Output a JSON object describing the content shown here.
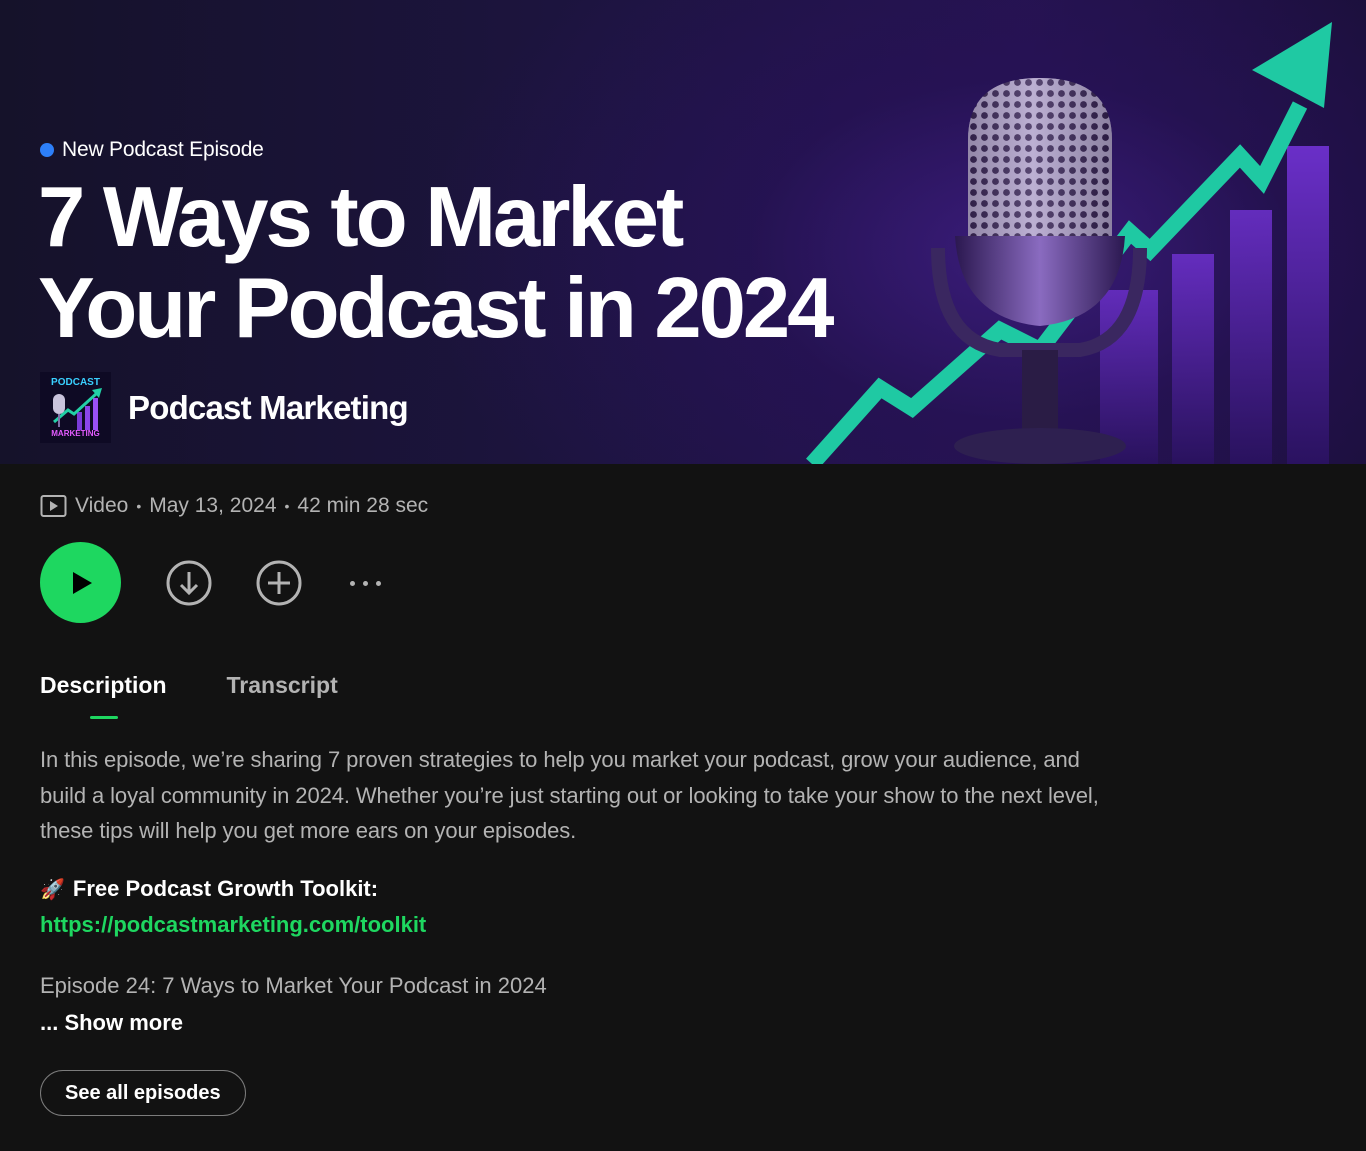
{
  "hero": {
    "badge": "New Podcast Episode",
    "title_line1": "7 Ways to Market",
    "title_line2": "Your Podcast in 2024",
    "show_name": "Podcast Marketing",
    "logo_top": "PODCAST",
    "logo_bottom": "MARKETING"
  },
  "meta": {
    "type": "Video",
    "separator": "•",
    "date": "May 13, 2024",
    "duration": "42 min 28 sec"
  },
  "actions": {
    "play_icon": "play-icon",
    "download_icon": "download-icon",
    "add_icon": "add-icon",
    "more_icon": "more-icon"
  },
  "tabs": {
    "description": "Description",
    "transcript": "Transcript",
    "active": "Description"
  },
  "description": {
    "paragraph": "In this episode, we’re sharing 7 proven strategies to help you market your podcast, grow your audience, and build a loyal community in 2024. Whether you’re just starting out or looking to take your show to the next level, these tips will help you get more ears on your episodes.",
    "toolkit_emoji": "🚀",
    "toolkit_label": "Free Podcast Growth Toolkit:",
    "toolkit_url": "https://podcastmarketing.com/toolkit",
    "episode_line": "Episode 24: 7 Ways to Market Your Podcast in 2024",
    "show_more": "... Show more"
  },
  "footer": {
    "see_all": "See all episodes"
  },
  "colors": {
    "accent_green": "#1ed760",
    "badge_blue": "#2d7ff9",
    "background": "#121212",
    "secondary_text": "#b3b3b3"
  }
}
